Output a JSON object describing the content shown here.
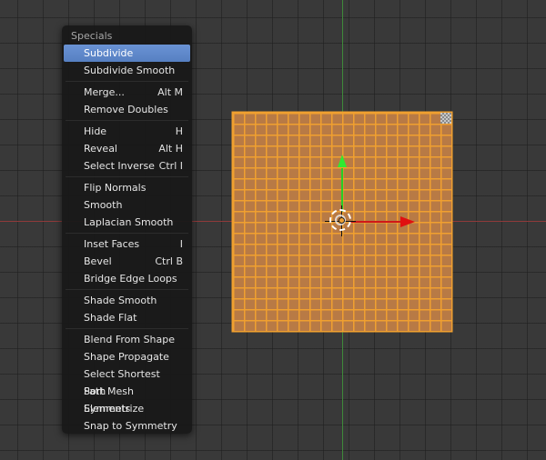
{
  "menu": {
    "title": "Specials",
    "groups": [
      [
        {
          "label": "Subdivide",
          "shortcut": "",
          "active": true
        },
        {
          "label": "Subdivide Smooth",
          "shortcut": ""
        }
      ],
      [
        {
          "label": "Merge...",
          "shortcut": "Alt M"
        },
        {
          "label": "Remove Doubles",
          "shortcut": ""
        }
      ],
      [
        {
          "label": "Hide",
          "shortcut": "H"
        },
        {
          "label": "Reveal",
          "shortcut": "Alt H"
        },
        {
          "label": "Select Inverse",
          "shortcut": "Ctrl I"
        }
      ],
      [
        {
          "label": "Flip Normals",
          "shortcut": ""
        },
        {
          "label": "Smooth",
          "shortcut": ""
        },
        {
          "label": "Laplacian Smooth",
          "shortcut": ""
        }
      ],
      [
        {
          "label": "Inset Faces",
          "shortcut": "I"
        },
        {
          "label": "Bevel",
          "shortcut": "Ctrl B"
        },
        {
          "label": "Bridge Edge Loops",
          "shortcut": ""
        }
      ],
      [
        {
          "label": "Shade Smooth",
          "shortcut": ""
        },
        {
          "label": "Shade Flat",
          "shortcut": ""
        }
      ],
      [
        {
          "label": "Blend From Shape",
          "shortcut": ""
        },
        {
          "label": "Shape Propagate",
          "shortcut": ""
        },
        {
          "label": "Select Shortest Path",
          "shortcut": ""
        },
        {
          "label": "Sort Mesh Elements",
          "shortcut": ""
        },
        {
          "label": "Symmetrize",
          "shortcut": ""
        },
        {
          "label": "Snap to Symmetry",
          "shortcut": ""
        }
      ]
    ]
  },
  "viewport": {
    "background": "#393939",
    "mesh_face_color": "#b87a45",
    "mesh_edge_color": "#f0a030",
    "x_axis_color": "#8f3a3a",
    "y_axis_color": "#3f8a3a",
    "manipulator_x_color": "#e01010",
    "manipulator_y_color": "#30ea30",
    "icons": [
      "3d-cursor-icon",
      "manipulator-x-arrow-icon",
      "manipulator-y-arrow-icon",
      "object-origin-icon"
    ]
  }
}
